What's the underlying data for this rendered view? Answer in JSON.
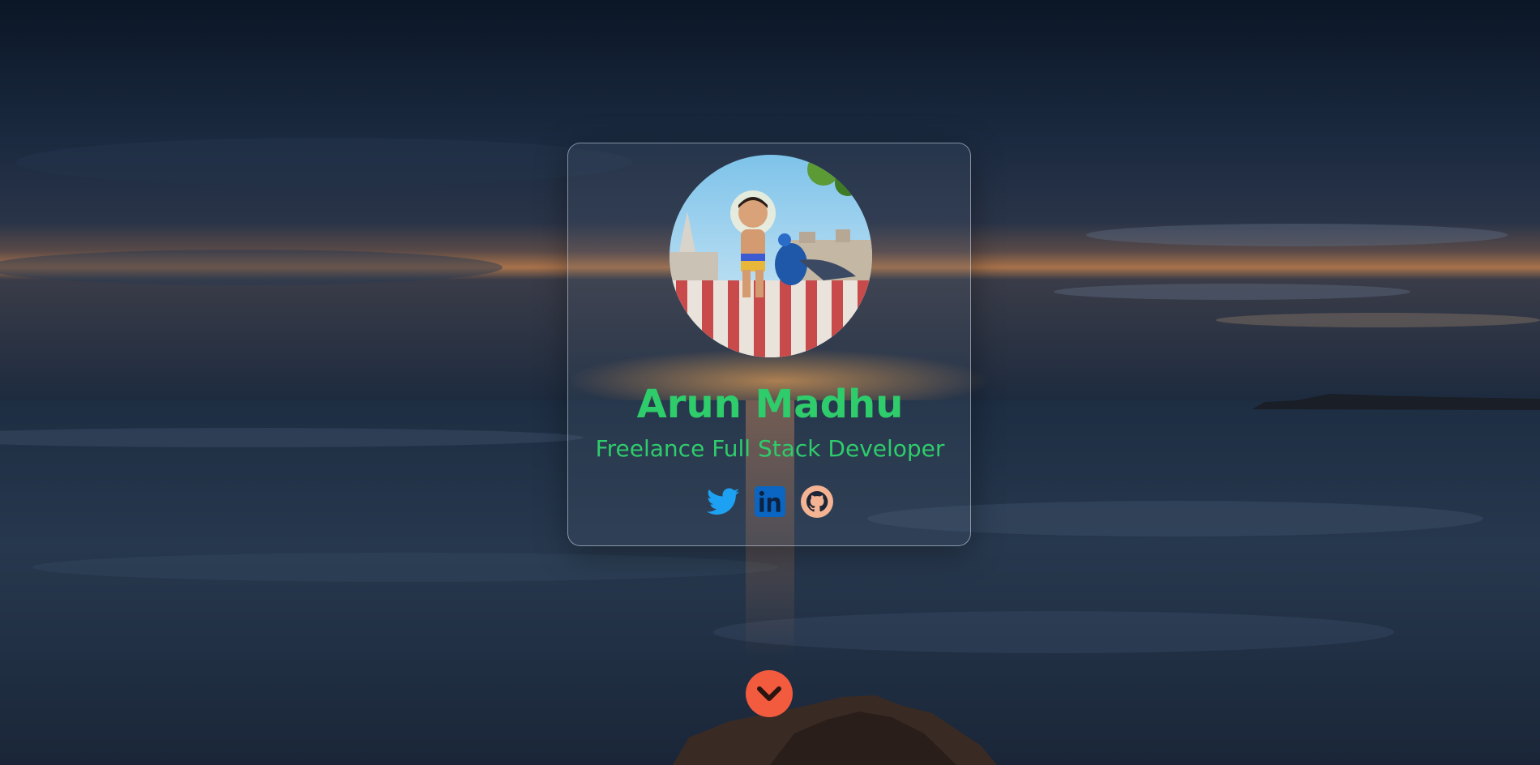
{
  "profile": {
    "name": "Arun Madhu",
    "title": "Freelance Full Stack Developer"
  },
  "social_links": [
    {
      "network": "Twitter",
      "icon": "twitter-icon",
      "color": "#1da1f2"
    },
    {
      "network": "LinkedIn",
      "icon": "linkedin-icon",
      "color": "#0a66c2"
    },
    {
      "network": "GitHub",
      "icon": "github-icon",
      "color": "#f4b392"
    }
  ],
  "scroll_button": {
    "icon": "chevron-down-icon",
    "color": "#f35b3f"
  },
  "colors": {
    "accent": "#2ecc6b",
    "card_border": "#d2dceb"
  }
}
